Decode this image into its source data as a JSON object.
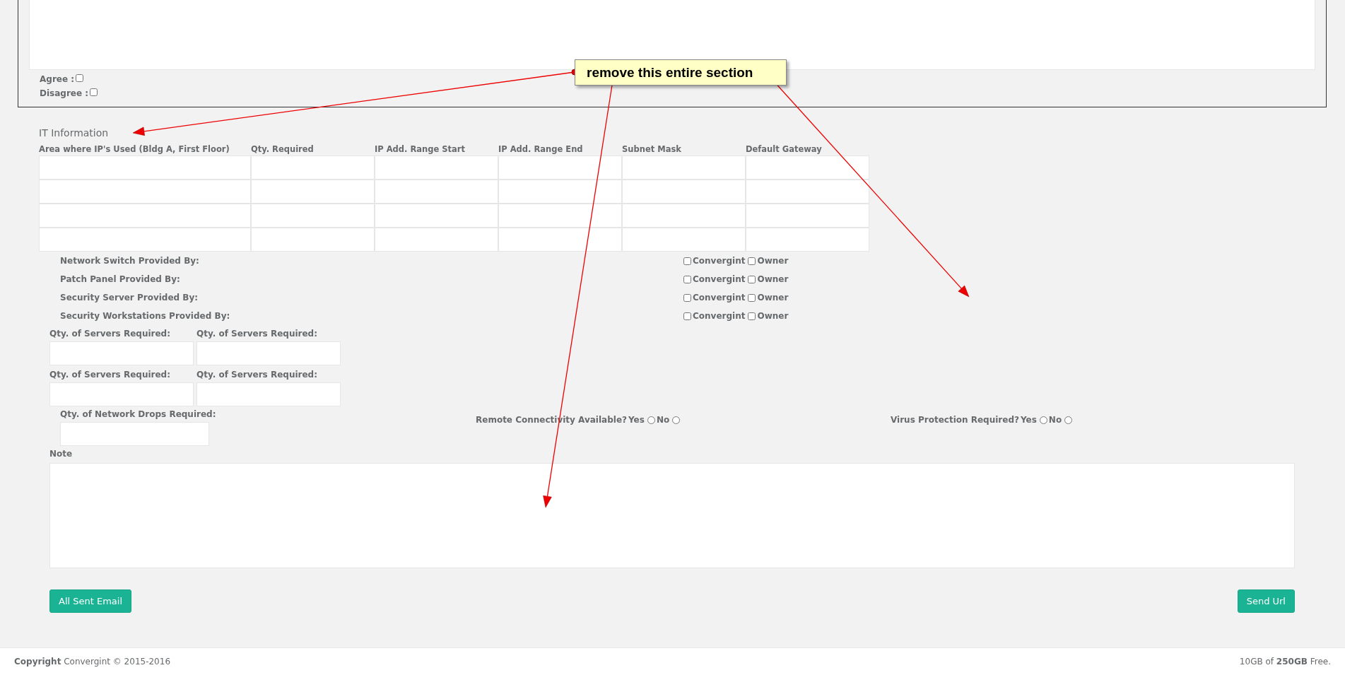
{
  "agreement": {
    "options": [
      {
        "label": "Agree :",
        "checked": false
      },
      {
        "label": "Disagree :",
        "checked": false
      }
    ]
  },
  "it_information": {
    "title": "IT Information",
    "columns": [
      "Area where IP's Used (Bldg A, First Floor)",
      "Qty. Required",
      "IP Add. Range Start",
      "IP Add. Range End",
      "Subnet Mask",
      "Default Gateway"
    ],
    "rows": [
      [
        "",
        "",
        "",
        "",
        "",
        ""
      ],
      [
        "",
        "",
        "",
        "",
        "",
        ""
      ],
      [
        "",
        "",
        "",
        "",
        "",
        ""
      ],
      [
        "",
        "",
        "",
        "",
        "",
        ""
      ]
    ]
  },
  "provided_by": [
    {
      "label": "Network Switch Provided By:",
      "options": [
        {
          "label": "Convergint",
          "checked": false
        },
        {
          "label": "Owner",
          "checked": false
        }
      ]
    },
    {
      "label": "Patch Panel Provided By:",
      "options": [
        {
          "label": "Convergint",
          "checked": false
        },
        {
          "label": "Owner",
          "checked": false
        }
      ]
    },
    {
      "label": "Security Server Provided By:",
      "options": [
        {
          "label": "Convergint",
          "checked": false
        },
        {
          "label": "Owner",
          "checked": false
        }
      ]
    },
    {
      "label": "Security Workstations Provided By:",
      "options": [
        {
          "label": "Convergint",
          "checked": false
        },
        {
          "label": "Owner",
          "checked": false
        }
      ]
    }
  ],
  "server_fields": [
    {
      "label": "Qty. of Servers Required:"
    },
    {
      "label": "Qty. of Servers Required:"
    },
    {
      "label": "Qty. of Servers Required:"
    },
    {
      "label": "Qty. of Servers Required:"
    }
  ],
  "network_drops": {
    "label": "Qty. of Network Drops Required:"
  },
  "questions": [
    {
      "label": "Remote Connectivity Available?",
      "options": [
        {
          "label": "Yes",
          "selected": false
        },
        {
          "label": "No",
          "selected": false
        }
      ]
    },
    {
      "label": "Virus Protection Required?",
      "options": [
        {
          "label": "Yes",
          "selected": false
        },
        {
          "label": "No",
          "selected": false
        }
      ]
    }
  ],
  "note": {
    "label": "Note"
  },
  "buttons": {
    "left": "All Sent Email",
    "right": "Send Url"
  },
  "footer": {
    "copyright": "**Copyright** Convergint © 2015-2016",
    "storage": "10GB of **250GB** Free."
  },
  "annotation": {
    "text": "remove this entire section"
  }
}
